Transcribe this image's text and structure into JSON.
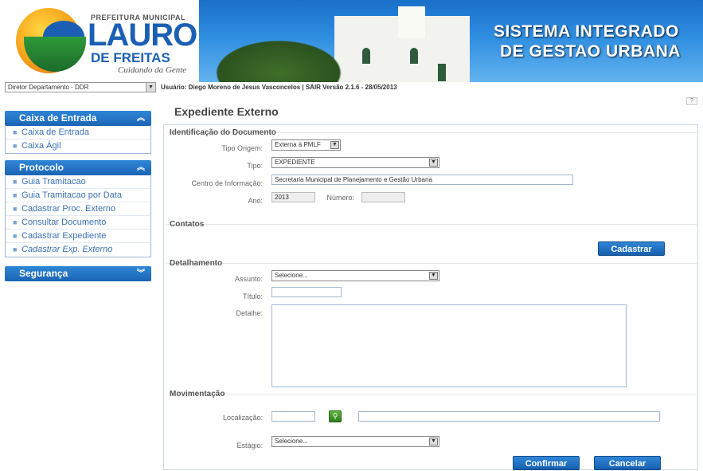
{
  "header": {
    "prefeitura": "PREFEITURA MUNICIPAL",
    "lauro": "LAURO",
    "freitas": "DE FREITAS",
    "slogan": "Cuidando da Gente",
    "system_line1": "SISTEMA INTEGRADO",
    "system_line2": "DE GESTAO URBANA"
  },
  "topbar": {
    "department": "Diretor Departamento - DDR",
    "user_info": "Usuário: Diego Moreno de Jesus Vasconcelos | SAIR Versão 2.1.6 - 28/05/2013",
    "help_label": "?"
  },
  "sidebar": {
    "sections": [
      {
        "title": "Caixa de Entrada",
        "items": [
          "Caixa de Entrada",
          "Caixa Ágil"
        ]
      },
      {
        "title": "Protocolo",
        "items": [
          "Guia Tramitacao",
          "Guia Tramitacao por Data",
          "Cadastrar Proc. Externo",
          "Consultar Documento",
          "Cadastrar Expediente",
          "Cadastrar Exp. Externo"
        ]
      },
      {
        "title": "Segurança",
        "items": []
      }
    ]
  },
  "main": {
    "title": "Expediente Externo",
    "identificacao": {
      "legend": "Identificação do Documento",
      "tipo_origem_label": "Tipo Origem:",
      "tipo_origem_value": "Externa à PMLF",
      "tipo_label": "Tipo:",
      "tipo_value": "EXPEDIENTE",
      "centro_label": "Centro de Informação:",
      "centro_value": "Secretaria Municipal de Planejamento e Gestão Urbana",
      "ano_label": "Ano:",
      "ano_value": "2013",
      "numero_label": "Número:",
      "numero_value": ""
    },
    "contatos": {
      "legend": "Contatos",
      "cadastrar_label": "Cadastrar"
    },
    "detalhamento": {
      "legend": "Detalhamento",
      "assunto_label": "Assunto:",
      "assunto_value": "Selecione...",
      "titulo_label": "Título:",
      "titulo_value": "",
      "detalhe_label": "Detalhe:",
      "detalhe_value": ""
    },
    "movimentacao": {
      "legend": "Movimentação",
      "localizacao_label": "Localização:",
      "localizacao_code": "",
      "localizacao_desc": "",
      "estagio_label": "Estágio:",
      "estagio_value": "Selecione..."
    },
    "actions": {
      "confirmar": "Confirmar",
      "cancelar": "Cancelar"
    }
  }
}
